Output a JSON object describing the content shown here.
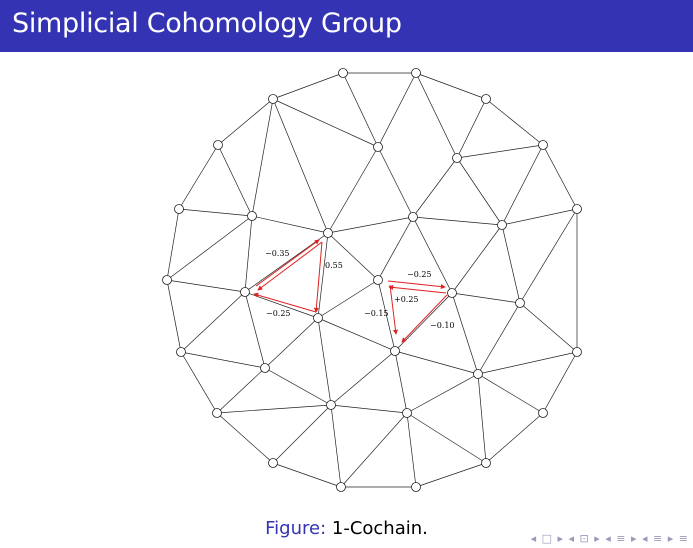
{
  "title": "Simplicial Cohomology Group",
  "caption": {
    "prefix": "Figure:",
    "text": "1-Cochain."
  },
  "nav_icons": [
    "arrow-left-icon",
    "frame-icon",
    "arrow-right-icon",
    "section-icon",
    "subsection-icon",
    "align-icon"
  ],
  "nav_text": "◂ □ ▸ ◂ ⊡ ▸ ◂ ≡ ▸ ◂ ≡ ▸  ≡",
  "colors": {
    "title_bg": "#3333b3",
    "title_fg": "#ffffff",
    "caption_figure": "#3333b3",
    "cochain_arrow": "#e02020"
  },
  "cochain_labels": [
    "−0.35",
    "0.55",
    "−0.25",
    "−0.25",
    "+0.25",
    "−0.15",
    "−0.10"
  ]
}
